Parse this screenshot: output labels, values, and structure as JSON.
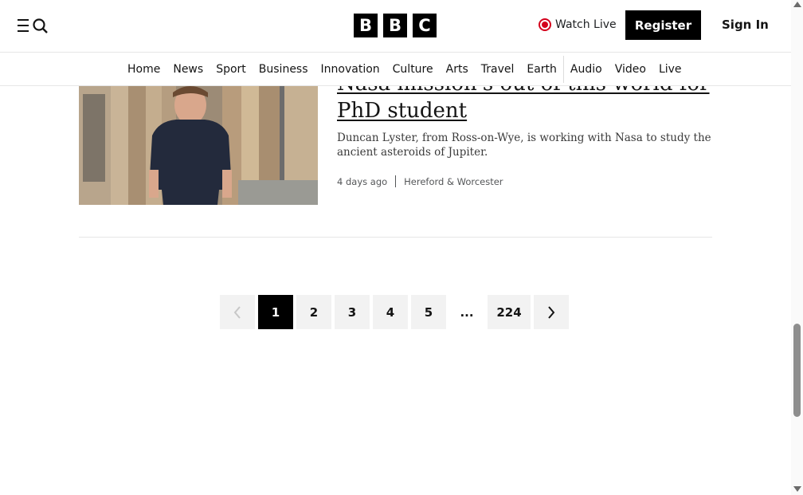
{
  "header": {
    "logo_letters": [
      "B",
      "B",
      "C"
    ],
    "watch_live_label": "Watch Live",
    "register_label": "Register",
    "signin_label": "Sign In",
    "menu_icon": "menu-search-icon"
  },
  "nav": {
    "items": [
      "Home",
      "News",
      "Sport",
      "Business",
      "Innovation",
      "Culture",
      "Arts",
      "Travel",
      "Earth",
      "Audio",
      "Video",
      "Live"
    ]
  },
  "article": {
    "headline_partial": "Nasa mission's out of this world for",
    "headline_line2": "PhD student",
    "summary": "Duncan Lyster, from Ross-on-Wye, is working with Nasa to study the ancient asteroids of Jupiter.",
    "time": "4 days ago",
    "topic": "Hereford & Worcester"
  },
  "pagination": {
    "prev_icon": "chevron-left-icon",
    "pages": [
      "1",
      "2",
      "3",
      "4",
      "5"
    ],
    "current": "1",
    "ellipsis": "...",
    "last": "224",
    "next_icon": "chevron-right-icon"
  },
  "colors": {
    "accent_live": "#d4001c",
    "brand_black": "#000000"
  }
}
